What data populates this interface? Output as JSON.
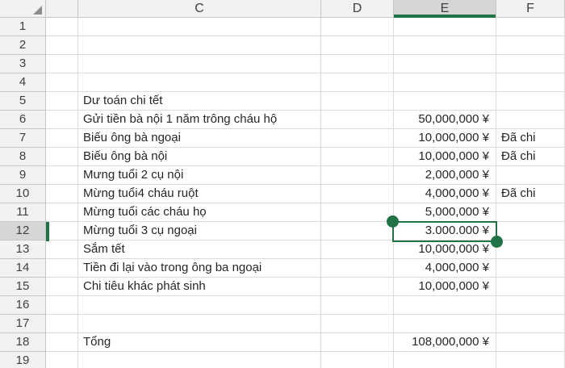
{
  "app": {
    "type": "spreadsheet",
    "accent_green": "#217346",
    "highlight_gray": "#d5d6d5",
    "currency_symbol": "¥"
  },
  "grid": {
    "column_headers": [
      {
        "key": "b",
        "label": "",
        "active": false
      },
      {
        "key": "c",
        "label": "C",
        "active": false
      },
      {
        "key": "d",
        "label": "D",
        "active": false
      },
      {
        "key": "e",
        "label": "E",
        "active": true
      },
      {
        "key": "f",
        "label": "F",
        "active": false
      }
    ],
    "rows": [
      {
        "n": "1",
        "c": "",
        "e": "",
        "f": "",
        "selected": false
      },
      {
        "n": "2",
        "c": "",
        "e": "",
        "f": "",
        "selected": false
      },
      {
        "n": "3",
        "c": "",
        "e": "",
        "f": "",
        "selected": false
      },
      {
        "n": "4",
        "c": "",
        "e": "",
        "f": "",
        "selected": false
      },
      {
        "n": "5",
        "c": "Dư toán chi tết",
        "e": "",
        "f": "",
        "selected": false
      },
      {
        "n": "6",
        "c": "Gửi tiền bà nội 1 năm trông cháu hộ",
        "e": "50,000,000 ¥",
        "f": "",
        "selected": false
      },
      {
        "n": "7",
        "c": "Biếu ông bà ngoại",
        "e": "10,000,000 ¥",
        "f": "Đã chi",
        "selected": false
      },
      {
        "n": "8",
        "c": "Biếu ông bà nội",
        "e": "10,000,000 ¥",
        "f": "Đã chi",
        "selected": false
      },
      {
        "n": "9",
        "c": "Mưng tuổi 2 cụ nội",
        "e": "2,000,000 ¥",
        "f": "",
        "selected": false
      },
      {
        "n": "10",
        "c": "Mừng tuổi4 cháu ruột",
        "e": "4,000,000 ¥",
        "f": "Đã chi",
        "selected": false
      },
      {
        "n": "11",
        "c": "Mừng tuổi các cháu họ",
        "e": "5,000,000 ¥",
        "f": "",
        "selected": false
      },
      {
        "n": "12",
        "c": "Mừng tuổi 3  cụ ngoại",
        "e": "3.000.000 ¥",
        "f": "",
        "selected": true
      },
      {
        "n": "13",
        "c": "Sắm tết",
        "e": "10,000,000 ¥",
        "f": "",
        "selected": false
      },
      {
        "n": "14",
        "c": "Tiền đi lại vào trong ông ba ngoại",
        "e": "4,000,000 ¥",
        "f": "",
        "selected": false
      },
      {
        "n": "15",
        "c": "Chi tiêu khác phát sinh",
        "e": "10,000,000 ¥",
        "f": "",
        "selected": false
      },
      {
        "n": "16",
        "c": "",
        "e": "",
        "f": "",
        "selected": false
      },
      {
        "n": "17",
        "c": "",
        "e": "",
        "f": "",
        "selected": false
      },
      {
        "n": "18",
        "c": "Tổng",
        "e": "108,000,000 ¥",
        "f": "",
        "selected": false
      },
      {
        "n": "19",
        "c": "",
        "e": "",
        "f": "",
        "selected": false
      }
    ]
  },
  "selection": {
    "active_cell": "E12",
    "active_value": "3.000.000 ¥",
    "active_column": "E",
    "active_row": "12"
  }
}
